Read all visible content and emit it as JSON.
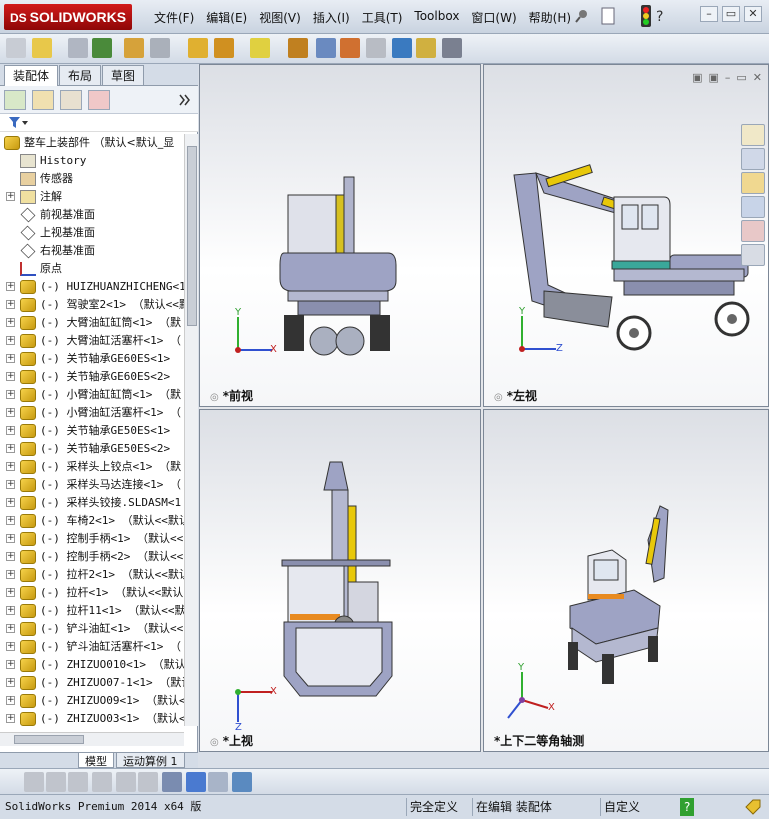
{
  "app": {
    "logo_text": "SOLIDWORKS",
    "logo_mark": "DS"
  },
  "menu": [
    "文件(F)",
    "编辑(E)",
    "视图(V)",
    "插入(I)",
    "工具(T)",
    "Toolbox",
    "窗口(W)",
    "帮助(H)"
  ],
  "window_buttons": {
    "minimize": "–",
    "restore": "▭",
    "close": "✕"
  },
  "panel_tabs": [
    "装配体",
    "布局",
    "草图"
  ],
  "tree": {
    "root": "整车上装部件 （默认<默认_显",
    "items": [
      {
        "label": "History",
        "expand": "",
        "icon": "history-icon"
      },
      {
        "label": "传感器",
        "expand": "",
        "icon": "sensor-icon"
      },
      {
        "label": "注解",
        "expand": "+",
        "icon": "annotation-icon"
      },
      {
        "label": "前视基准面",
        "expand": "",
        "icon": "plane-icon"
      },
      {
        "label": "上视基准面",
        "expand": "",
        "icon": "plane-icon"
      },
      {
        "label": "右视基准面",
        "expand": "",
        "icon": "plane-icon"
      },
      {
        "label": "原点",
        "expand": "",
        "icon": "origin-icon"
      },
      {
        "label": "(-) HUIZHUANZHICHENG<1>",
        "expand": "+",
        "icon": "component-icon"
      },
      {
        "label": "(-) 驾驶室2<1> （默认<<默",
        "expand": "+",
        "icon": "component-icon"
      },
      {
        "label": "(-) 大臂油缸缸筒<1> （默",
        "expand": "+",
        "icon": "component-icon"
      },
      {
        "label": "(-) 大臂油缸活塞杆<1> （",
        "expand": "+",
        "icon": "component-icon"
      },
      {
        "label": "(-) 关节轴承GE60ES<1> （",
        "expand": "+",
        "icon": "component-icon"
      },
      {
        "label": "(-) 关节轴承GE60ES<2> （",
        "expand": "+",
        "icon": "component-icon"
      },
      {
        "label": "(-) 小臂油缸缸筒<1> （默",
        "expand": "+",
        "icon": "component-icon"
      },
      {
        "label": "(-) 小臂油缸活塞杆<1> （",
        "expand": "+",
        "icon": "component-icon"
      },
      {
        "label": "(-) 关节轴承GE50ES<1> （",
        "expand": "+",
        "icon": "component-icon"
      },
      {
        "label": "(-) 关节轴承GE50ES<2> （",
        "expand": "+",
        "icon": "component-icon"
      },
      {
        "label": "(-) 采样头上铰点<1> （默",
        "expand": "+",
        "icon": "component-icon"
      },
      {
        "label": "(-) 采样头马达连接<1> （",
        "expand": "+",
        "icon": "component-icon"
      },
      {
        "label": "(-) 采样头铰接.SLDASM<1",
        "expand": "+",
        "icon": "component-icon"
      },
      {
        "label": "(-) 车椅2<1> （默认<<默认",
        "expand": "+",
        "icon": "component-icon"
      },
      {
        "label": "(-) 控制手柄<1> （默认<<",
        "expand": "+",
        "icon": "component-icon"
      },
      {
        "label": "(-) 控制手柄<2> （默认<<",
        "expand": "+",
        "icon": "component-icon"
      },
      {
        "label": "(-) 拉杆2<1> （默认<<默认",
        "expand": "+",
        "icon": "component-icon"
      },
      {
        "label": "(-) 拉杆<1> （默认<<默认",
        "expand": "+",
        "icon": "component-icon"
      },
      {
        "label": "(-) 拉杆11<1> （默认<<默",
        "expand": "+",
        "icon": "component-icon"
      },
      {
        "label": "(-) 铲斗油缸<1> （默认<<",
        "expand": "+",
        "icon": "component-icon"
      },
      {
        "label": "(-) 铲斗油缸活塞杆<1> （",
        "expand": "+",
        "icon": "component-icon"
      },
      {
        "label": "(-) ZHIZUO010<1> （默认<<",
        "expand": "+",
        "icon": "component-icon"
      },
      {
        "label": "(-) ZHIZUO07-1<1> （默认",
        "expand": "+",
        "icon": "component-icon"
      },
      {
        "label": "(-) ZHIZUO09<1> （默认<<默",
        "expand": "+",
        "icon": "component-icon"
      },
      {
        "label": "(-) ZHIZUO03<1> （默认<<默",
        "expand": "+",
        "icon": "component-icon"
      }
    ]
  },
  "bottom_tabs": [
    "模型",
    "运动算例 1"
  ],
  "viewports": [
    {
      "label": "*前视",
      "axis_h": "X",
      "axis_v": "Y"
    },
    {
      "label": "*左视",
      "axis_h": "Z",
      "axis_v": "Y"
    },
    {
      "label": "*上视",
      "axis_h": "X",
      "axis_v": "Z"
    },
    {
      "label": "*上下二等角轴测",
      "axis_h": "X",
      "axis_v": "Y"
    }
  ],
  "status": {
    "version": "SolidWorks Premium 2014 x64 版",
    "defined": "完全定义",
    "editing": "在编辑 装配体",
    "custom": "自定义",
    "help": "?"
  },
  "colors": {
    "machine_body": "#9ea3c4",
    "accent_yellow": "#e8c80a",
    "cab_teal": "#3aa89a",
    "brand_red": "#c01010"
  }
}
